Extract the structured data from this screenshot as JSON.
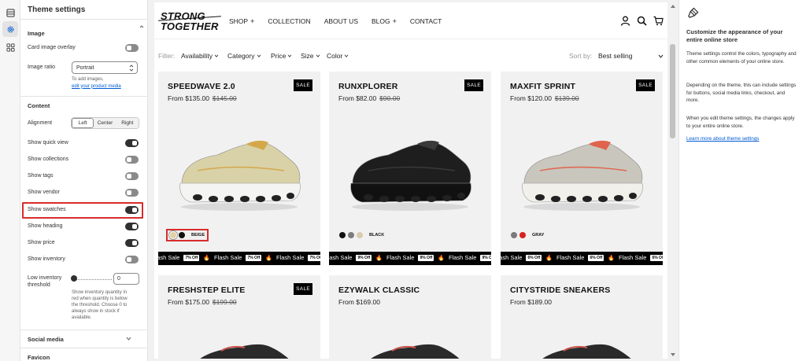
{
  "panel": {
    "title": "Theme settings",
    "image_section": {
      "title": "Image",
      "card_overlay_label": "Card image overlay",
      "card_overlay_on": false,
      "ratio_label": "Image ratio",
      "ratio_value": "Portrait",
      "ratio_help": "To add images,",
      "ratio_link": "edit your product media"
    },
    "content_section": {
      "title": "Content",
      "alignment_label": "Alignment",
      "alignment_options": [
        "Left",
        "Center",
        "Right"
      ],
      "alignment_selected": "Left",
      "toggles": [
        {
          "label": "Show quick view",
          "on": true
        },
        {
          "label": "Show collections",
          "on": false
        },
        {
          "label": "Show tags",
          "on": false
        },
        {
          "label": "Show vendor",
          "on": false
        },
        {
          "label": "Show swatches",
          "on": true
        },
        {
          "label": "Show heading",
          "on": true
        },
        {
          "label": "Show price",
          "on": true
        },
        {
          "label": "Show inventory",
          "on": false
        }
      ],
      "threshold_label": "Low inventory threshold",
      "threshold_value": "0",
      "threshold_help": "Show inventory quantity in red when quantity is below the threshold. Choose 0 to always show in stock if available."
    },
    "collapsed_sections": [
      "Social media",
      "Favicon"
    ]
  },
  "store": {
    "logo_line1": "STRONG",
    "logo_line2": "TOGETHER",
    "nav": [
      {
        "label": "SHOP",
        "plus": "+"
      },
      {
        "label": "COLLECTION",
        "plus": ""
      },
      {
        "label": "ABOUT US",
        "plus": ""
      },
      {
        "label": "BLOG",
        "plus": "+"
      },
      {
        "label": "CONTACT",
        "plus": ""
      }
    ],
    "filter_label": "Filter:",
    "filters": [
      "Availability",
      "Category",
      "Price",
      "Size",
      "Color"
    ],
    "sort_label": "Sort by:",
    "sort_value": "Best selling",
    "ticker": {
      "text": "Flash Sale",
      "offs": [
        "7% Off",
        "9% Off",
        "6% Off"
      ]
    },
    "sale_badge": "SALE",
    "products": [
      {
        "name": "SPEEDWAVE 2.0",
        "price": "From $135.00",
        "compare": "$145.00",
        "sale": true,
        "swatch_label": "BEIGE",
        "swatches": [
          "#e3cfa5",
          "#111111"
        ],
        "shoe_color": "#d9d2a8",
        "accent": "#d4a84a",
        "sole": "#f4f4f2"
      },
      {
        "name": "RUNXPLORER",
        "price": "From $82.00",
        "compare": "$90.00",
        "sale": true,
        "swatch_label": "BLACK",
        "swatches": [
          "#111111",
          "#7c7c7c",
          "#d9ccb0"
        ],
        "shoe_color": "#1e1e1e",
        "accent": "#3a3a3a",
        "sole": "#111111"
      },
      {
        "name": "MAXFIT SPRINT",
        "price": "From $120.00",
        "compare": "$139.00",
        "sale": true,
        "swatch_label": "GRAY",
        "swatches": [
          "#7a7a7a",
          "#d92020"
        ],
        "shoe_color": "#c9c6bd",
        "accent": "#e0644d",
        "sole": "#f2f0ea"
      },
      {
        "name": "FRESHSTEP ELITE",
        "price": "From $175.00",
        "compare": "$199.00",
        "sale": true
      },
      {
        "name": "EZYWALK CLASSIC",
        "price": "From $169.00",
        "compare": "",
        "sale": false
      },
      {
        "name": "CITYSTRIDE SNEAKERS",
        "price": "From $189.00",
        "compare": "",
        "sale": false
      }
    ]
  },
  "help": {
    "title": "Customize the appearance of your entire online store",
    "p1": "Theme settings control the colors, typography and other common elements of your online store.",
    "p2": "Depending on the theme, this can include settings for buttons, social media links, checkout, and more.",
    "p3": "When you edit theme settings, the changes apply to your entire online store.",
    "link": "Learn more about theme settings"
  },
  "colors": {
    "highlight": "#d82c2c",
    "link": "#005bd3",
    "toggle_on": "#303030",
    "toggle_off": "#8a8a8a"
  }
}
